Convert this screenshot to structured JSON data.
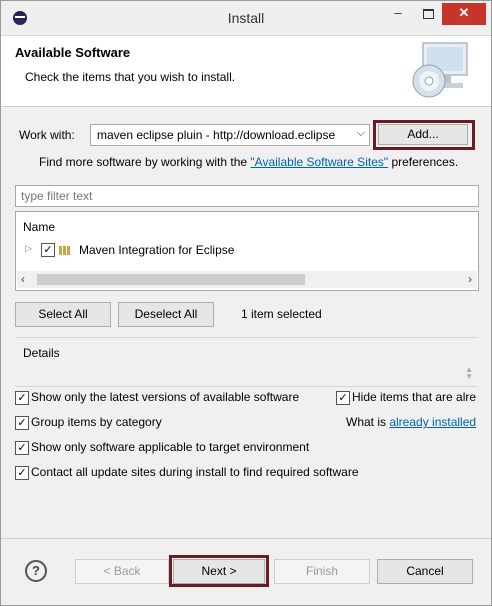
{
  "window": {
    "title": "Install"
  },
  "header": {
    "title": "Available Software",
    "subtitle": "Check the items that you wish to install."
  },
  "work_with": {
    "label": "Work with:",
    "value": "maven eclipse pluin - http://download.eclipse",
    "add_button": "Add..."
  },
  "sites": {
    "prefix": "Find more software by working with the ",
    "link": "\"Available Software Sites\"",
    "suffix": " preferences."
  },
  "filter": {
    "placeholder": "type filter text"
  },
  "tree": {
    "column_header": "Name",
    "items": [
      {
        "label": "Maven Integration for Eclipse",
        "checked": true
      }
    ]
  },
  "selection": {
    "select_all": "Select All",
    "deselect_all": "Deselect All",
    "status": "1 item selected"
  },
  "details": {
    "label": "Details"
  },
  "options": {
    "latest_versions": {
      "label": "Show only the latest versions of available software",
      "checked": true
    },
    "hide_installed": {
      "label": "Hide items that are alre",
      "checked": true
    },
    "group_by_category": {
      "label": "Group items by category",
      "checked": true
    },
    "what_is": {
      "prefix": "What is ",
      "link": "already installed"
    },
    "applicable_only": {
      "label": "Show only software applicable to target environment",
      "checked": true
    },
    "contact_sites": {
      "label": "Contact all update sites during install to find required software",
      "checked": true
    }
  },
  "footer": {
    "help": "?",
    "back": "< Back",
    "next": "Next >",
    "finish": "Finish",
    "cancel": "Cancel"
  },
  "colors": {
    "highlight": "#6b1a26",
    "link": "#0063b1",
    "close": "#c7352a"
  }
}
